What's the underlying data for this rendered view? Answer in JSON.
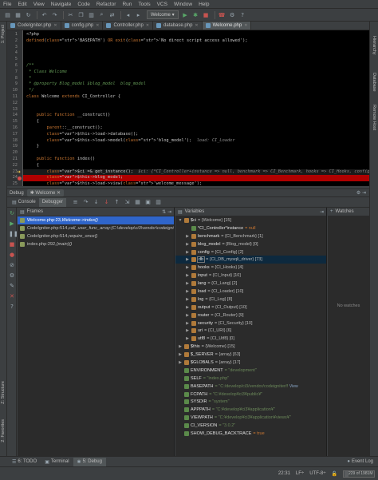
{
  "menu": [
    "File",
    "Edit",
    "View",
    "Navigate",
    "Code",
    "Refactor",
    "Run",
    "Tools",
    "VCS",
    "Window",
    "Help"
  ],
  "toolbar": {
    "config_label": "Welcome"
  },
  "left_strip": {
    "project": "1: Project",
    "structure": "Z: Structure",
    "favorites": "2: Favorites"
  },
  "right_strip": {
    "remote": "Remote Host",
    "database": "Database",
    "hierarchy": "Hierarchy"
  },
  "tabs": [
    {
      "label": "CodeIgniter.php",
      "active": false
    },
    {
      "label": "config.php",
      "active": false
    },
    {
      "label": "Controller.php",
      "active": false
    },
    {
      "label": "database.php",
      "active": false
    },
    {
      "label": "Welcome.php",
      "active": true
    }
  ],
  "editor": {
    "lines": [
      {
        "n": "1",
        "t": "<?php"
      },
      {
        "n": "2",
        "t": "defined('BASEPATH') OR exit('No direct script access allowed');"
      },
      {
        "n": "3",
        "t": ""
      },
      {
        "n": "4",
        "t": ""
      },
      {
        "n": "5",
        "t": ""
      },
      {
        "n": "6",
        "t": "/**"
      },
      {
        "n": "7",
        "t": " * Class Welcome"
      },
      {
        "n": "8",
        "t": " *"
      },
      {
        "n": "9",
        "t": " * @property Blog_model $blog_model  blog_model"
      },
      {
        "n": "10",
        "t": " */"
      },
      {
        "n": "11",
        "t": "class Welcome extends CI_Controller {"
      },
      {
        "n": "12",
        "t": ""
      },
      {
        "n": "13",
        "t": ""
      },
      {
        "n": "14",
        "t": "    public function __construct()"
      },
      {
        "n": "15",
        "t": "    {"
      },
      {
        "n": "16",
        "t": "        parent::__construct();"
      },
      {
        "n": "17",
        "t": "        $this->load->database();"
      },
      {
        "n": "18",
        "t": "        $this->load->model('blog_model');"
      },
      {
        "n": "19",
        "t": "    }"
      },
      {
        "n": "20",
        "t": ""
      },
      {
        "n": "21",
        "t": "    public function index()"
      },
      {
        "n": "22",
        "t": "    {"
      },
      {
        "n": "23",
        "t": "        $ci =& get_instance();"
      },
      {
        "n": "24",
        "t": "        $this->blog_model;"
      },
      {
        "n": "25",
        "t": "        $this->load->view('welcome_message');"
      },
      {
        "n": "26",
        "t": "    }"
      }
    ],
    "hint_line18": "load: CI_Loader",
    "hint_line23": "$ci: {*CI_Controller+instance => null, benchmark => CI_Benchmark, hooks => CI_Hooks, config => CI_Confi"
  },
  "debug": {
    "title": "Debug",
    "session_tab": "Welcome",
    "tabs": [
      "Console",
      "Debugger"
    ],
    "frames_title": "Frames",
    "frames": [
      {
        "file": "Welcome.php:23,",
        "fn": "Welcome->index()",
        "selected": true
      },
      {
        "file": "CodeIgniter.php:514,",
        "fn": "call_user_func_array:{C:\\develop\\ci3\\vendor\\codeigniter\\framework\\system\\core\\CodeIgniter.php}",
        "selected": false
      },
      {
        "file": "CodeIgniter.php:514,",
        "fn": "require_once()",
        "selected": false
      },
      {
        "file": "index.php:292,",
        "fn": "{main}()",
        "selected": false
      }
    ],
    "variables_title": "Variables",
    "variables": [
      {
        "indent": 0,
        "tw": "▼",
        "name": "$ci",
        "value": "= {Welcome} [15]",
        "kind": "obj"
      },
      {
        "indent": 1,
        "tw": "",
        "name": "*CI_Controller*instance",
        "value": "= null",
        "kind": "null"
      },
      {
        "indent": 1,
        "tw": "▶",
        "name": "benchmark",
        "value": "= {CI_Benchmark} [1]",
        "kind": "obj"
      },
      {
        "indent": 1,
        "tw": "▶",
        "name": "blog_model",
        "value": "= {Blog_model} [0]",
        "kind": "obj"
      },
      {
        "indent": 1,
        "tw": "▶",
        "name": "config",
        "value": "= {CI_Config} [2]",
        "kind": "obj"
      },
      {
        "indent": 1,
        "tw": "▶",
        "name": "db",
        "value": "= {CI_DB_mysqli_driver} [73]",
        "kind": "obj",
        "selected": true
      },
      {
        "indent": 1,
        "tw": "▶",
        "name": "hooks",
        "value": "= {CI_Hooks} [4]",
        "kind": "obj"
      },
      {
        "indent": 1,
        "tw": "▶",
        "name": "input",
        "value": "= {CI_Input} [10]",
        "kind": "obj"
      },
      {
        "indent": 1,
        "tw": "▶",
        "name": "lang",
        "value": "= {CI_Lang} [2]",
        "kind": "obj"
      },
      {
        "indent": 1,
        "tw": "▶",
        "name": "load",
        "value": "= {CI_Loader} [10]",
        "kind": "obj"
      },
      {
        "indent": 1,
        "tw": "▶",
        "name": "log",
        "value": "= {CI_Log} [8]",
        "kind": "obj"
      },
      {
        "indent": 1,
        "tw": "▶",
        "name": "output",
        "value": "= {CI_Output} [10]",
        "kind": "obj"
      },
      {
        "indent": 1,
        "tw": "▶",
        "name": "router",
        "value": "= {CI_Router} [9]",
        "kind": "obj"
      },
      {
        "indent": 1,
        "tw": "▶",
        "name": "security",
        "value": "= {CI_Security} [10]",
        "kind": "obj"
      },
      {
        "indent": 1,
        "tw": "▶",
        "name": "uri",
        "value": "= {CI_URI} [6]",
        "kind": "obj"
      },
      {
        "indent": 1,
        "tw": "▶",
        "name": "utf8",
        "value": "= {CI_Utf8} [0]",
        "kind": "obj"
      },
      {
        "indent": 0,
        "tw": "▶",
        "name": "$this",
        "value": "= {Welcome} [15]",
        "kind": "obj"
      },
      {
        "indent": 0,
        "tw": "▶",
        "name": "$_SERVER",
        "value": "= {array} [63]",
        "kind": "obj"
      },
      {
        "indent": 0,
        "tw": "▶",
        "name": "$GLOBALS",
        "value": "= {array} [17]",
        "kind": "obj"
      },
      {
        "indent": 0,
        "tw": "",
        "name": "ENVIRONMENT",
        "value": "= \"development\"",
        "kind": "str"
      },
      {
        "indent": 0,
        "tw": "",
        "name": "SELF",
        "value": "= \"index.php\"",
        "kind": "str"
      },
      {
        "indent": 0,
        "tw": "",
        "name": "BASEPATH",
        "value": "= \"C:/develop/ci3/vendor/codeigniter/f",
        "kind": "str",
        "view": "View"
      },
      {
        "indent": 0,
        "tw": "",
        "name": "FCPATH",
        "value": "= \"C:¥develop¥ci3¥public¥\"",
        "kind": "str"
      },
      {
        "indent": 0,
        "tw": "",
        "name": "SYSDIR",
        "value": "= \"system\"",
        "kind": "str"
      },
      {
        "indent": 0,
        "tw": "",
        "name": "APPPATH",
        "value": "= \"C:¥develop¥ci3¥application¥\"",
        "kind": "str"
      },
      {
        "indent": 0,
        "tw": "",
        "name": "VIEWPATH",
        "value": "= \"C:¥develop¥ci3¥application¥views¥\"",
        "kind": "str"
      },
      {
        "indent": 0,
        "tw": "",
        "name": "CI_VERSION",
        "value": "= \"3.0.2\"",
        "kind": "str"
      },
      {
        "indent": 0,
        "tw": "",
        "name": "SHOW_DEBUG_BACKTRACE",
        "value": "= true",
        "kind": "kw"
      }
    ],
    "watches_title": "Watches",
    "no_watches": "No watches"
  },
  "toolwindows": [
    {
      "icon": "☰",
      "label": "6: TODO",
      "active": false
    },
    {
      "icon": "▣",
      "label": "Terminal",
      "active": false
    },
    {
      "icon": "✱",
      "label": "5: Debug",
      "active": true
    }
  ],
  "event_log": "Event Log",
  "status": {
    "position": "22:31",
    "line_sep": "LF÷",
    "encoding": "UTF-8÷",
    "memory": "229 of 1981M",
    "memory_fraction": 0.12
  }
}
